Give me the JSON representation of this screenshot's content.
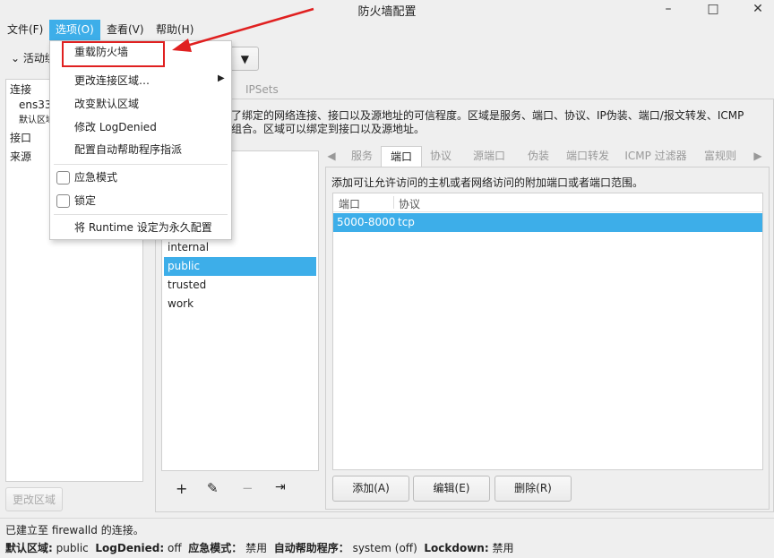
{
  "window": {
    "title": "防火墙配置",
    "min": "–",
    "max": "□",
    "close": "✕"
  },
  "menubar": [
    "文件(F)",
    "选项(O)",
    "查看(V)",
    "帮助(H)"
  ],
  "options_menu": {
    "items": [
      "重载防火墙",
      "更改连接区域…",
      "改变默认区域",
      "修改 LogDenied",
      "配置自动帮助程序指派"
    ],
    "checks": [
      "应急模式",
      "锁定"
    ],
    "last": "将 Runtime 设定为永久配置"
  },
  "active_bindings": {
    "label": "活动绑定",
    "items": [
      "连接",
      "ens33",
      "默认区域",
      "接口",
      "来源"
    ],
    "change_zone": "更改区域"
  },
  "top_tabs": {
    "ipsets": "IPSets"
  },
  "description": [
    "定义了绑定的网络连接、接口以及源地址的可信程度。区域是服务、端口、协议、IP伪装、端口/报文转发、ICMP",
    "则的组合。区域可以绑定到接口以及源地址。"
  ],
  "zones": {
    "items": [
      "internal",
      "public",
      "trusted",
      "work"
    ],
    "selected": "public"
  },
  "zone_tools": {
    "add": "+",
    "edit": "✎",
    "remove": "−",
    "load": "⇥"
  },
  "zone_tabs": {
    "prev": "◀",
    "next": "▶",
    "items": [
      "服务",
      "端口",
      "协议",
      "源端口",
      "伪装",
      "端口转发",
      "ICMP 过滤器",
      "富规则"
    ],
    "active": "端口"
  },
  "ports": {
    "hint": "添加可让允许访问的主机或者网络访问的附加端口或者端口范围。",
    "headers": [
      "端口",
      "协议"
    ],
    "rows": [
      [
        "5000-8000",
        "tcp"
      ]
    ],
    "add": "添加(A)",
    "edit": "编辑(E)",
    "remove": "删除(R)"
  },
  "status": {
    "line1": "已建立至 firewalld 的连接。",
    "fields": [
      [
        "默认区域:",
        "public"
      ],
      [
        "LogDenied:",
        "off"
      ],
      [
        "应急模式：",
        "禁用"
      ],
      [
        "自动帮助程序：",
        "system (off)"
      ],
      [
        "Lockdown:",
        "禁用"
      ]
    ]
  },
  "colors": {
    "accent": "#3daee9",
    "annotation": "#e02020"
  }
}
